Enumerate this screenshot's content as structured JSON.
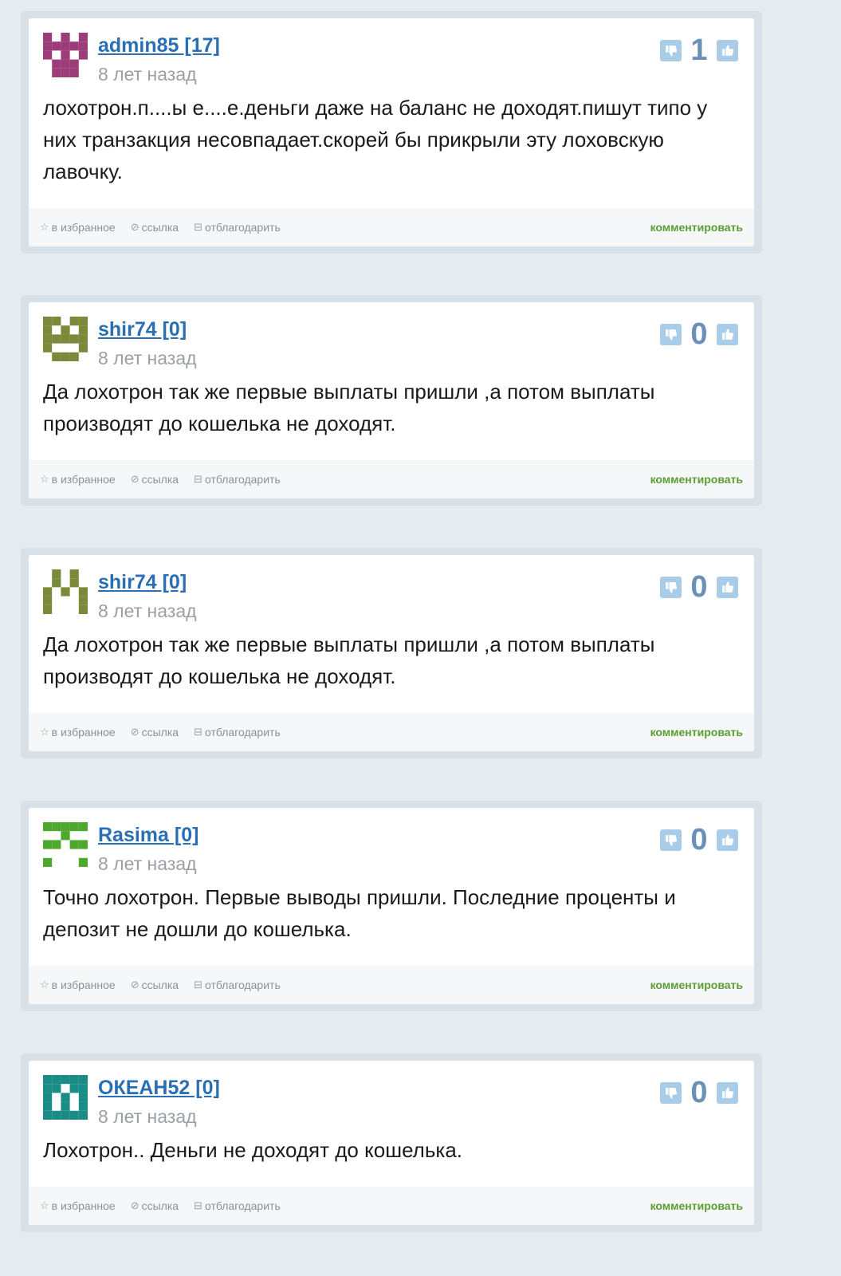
{
  "comments": [
    {
      "author": "admin85 [17]",
      "time": "8 лет назад",
      "score": "1",
      "text": "лохотрон.п....ы е....е.деньги даже на баланс не доходят.пишут типо у них транзакция несовпадает.скорей бы прикрыли эту лоховскую лавочку.",
      "avatar_color": "#9c3c78"
    },
    {
      "author": "shir74 [0]",
      "time": "8 лет назад",
      "score": "0",
      "text": "Да лохотрон так же первые выплаты пришли ,а потом выплаты производят до кошелька не доходят.",
      "avatar_color": "#7a8a3a"
    },
    {
      "author": "shir74 [0]",
      "time": "8 лет назад",
      "score": "0",
      "text": "Да лохотрон так же первые выплаты пришли ,а потом выплаты производят до кошелька не доходят.",
      "avatar_color": "#7a8a3a"
    },
    {
      "author": "Rasima [0]",
      "time": "8 лет назад",
      "score": "0",
      "text": "Точно лохотрон. Первые выводы пришли. Последние проценты и депозит не дошли до кошелька.",
      "avatar_color": "#4fa82e"
    },
    {
      "author": "ОКЕАН52 [0]",
      "time": "8 лет назад",
      "score": "0",
      "text": "Лохотрон.. Деньги не доходят до кошелька.",
      "avatar_color": "#1a8c86"
    }
  ],
  "footer": {
    "favorite": "в избранное",
    "link": "ссылка",
    "thank": "отблагодарить",
    "comment": "комментировать"
  },
  "icons": {
    "favorite": "star-icon",
    "link": "link-icon",
    "thank": "gift-icon",
    "vote_down": "thumbs-down-icon",
    "vote_up": "thumbs-up-icon"
  },
  "colors": {
    "page_bg": "#e6ebf0",
    "author_link": "#2a6fb3",
    "comment_link": "#5a9e33",
    "vote_button": "#a9cde9",
    "score": "#6a90b8"
  }
}
